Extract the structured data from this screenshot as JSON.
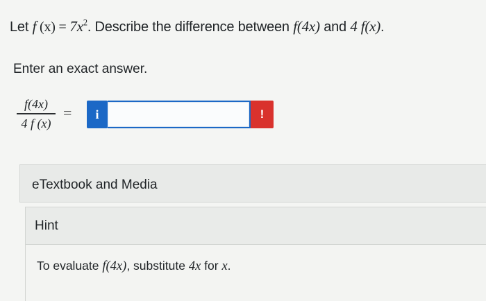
{
  "question": {
    "prefix": "Let ",
    "func_f": "f",
    "args_x": " (x) ",
    "equals": " = ",
    "coef_base": "7x",
    "exponent": "2",
    "mid_text": ". Describe the difference between ",
    "expr_f4x": "f(4x)",
    "and": " and ",
    "expr_4fx": "4 f(x)",
    "end": "."
  },
  "prompt": "Enter an exact answer.",
  "fraction": {
    "numerator": "f(4x)",
    "denominator": "4 f (x)"
  },
  "equals_sign": "=",
  "answer_input": {
    "value": "",
    "placeholder": ""
  },
  "info_button_label": "i",
  "error_flag_label": "!",
  "etextbook_label": "eTextbook and Media",
  "hint": {
    "title": "Hint",
    "text_before": "To evaluate ",
    "expr": "f(4x)",
    "text_mid": ", substitute ",
    "sub": "4x",
    "text_for": " for ",
    "var": "x",
    "text_end": "."
  },
  "colors": {
    "accent_blue": "#1b68c6",
    "error_red": "#d9322d"
  },
  "icons": {
    "info": "info-icon",
    "error": "exclamation-icon"
  }
}
